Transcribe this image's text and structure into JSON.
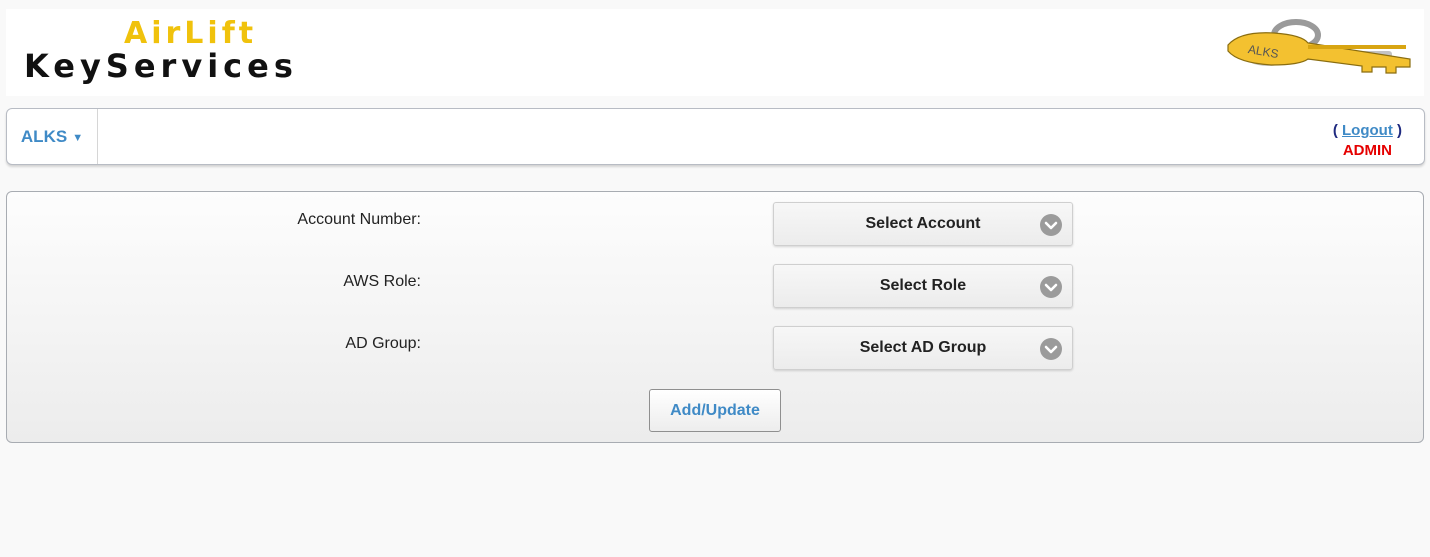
{
  "header": {
    "logo_line1": "AirLift",
    "logo_line2": "KeyServices",
    "key_logo_text": "ALKS",
    "key_color": "#f3c130"
  },
  "navbar": {
    "menu_label": "ALKS",
    "caret": "▼",
    "paren_open": "(",
    "logout_label": "Logout",
    "paren_close": ")",
    "user_role": "ADMIN",
    "accent_color": "#3f8ac6",
    "role_color": "#e50000"
  },
  "form": {
    "fields": [
      {
        "label": "Account Number:",
        "selected": "Select Account",
        "icon": "chevron-down-icon"
      },
      {
        "label": "AWS Role:",
        "selected": "Select Role",
        "icon": "chevron-down-icon"
      },
      {
        "label": "AD Group:",
        "selected": "Select AD Group",
        "icon": "chevron-down-icon"
      }
    ],
    "submit_label": "Add/Update"
  }
}
